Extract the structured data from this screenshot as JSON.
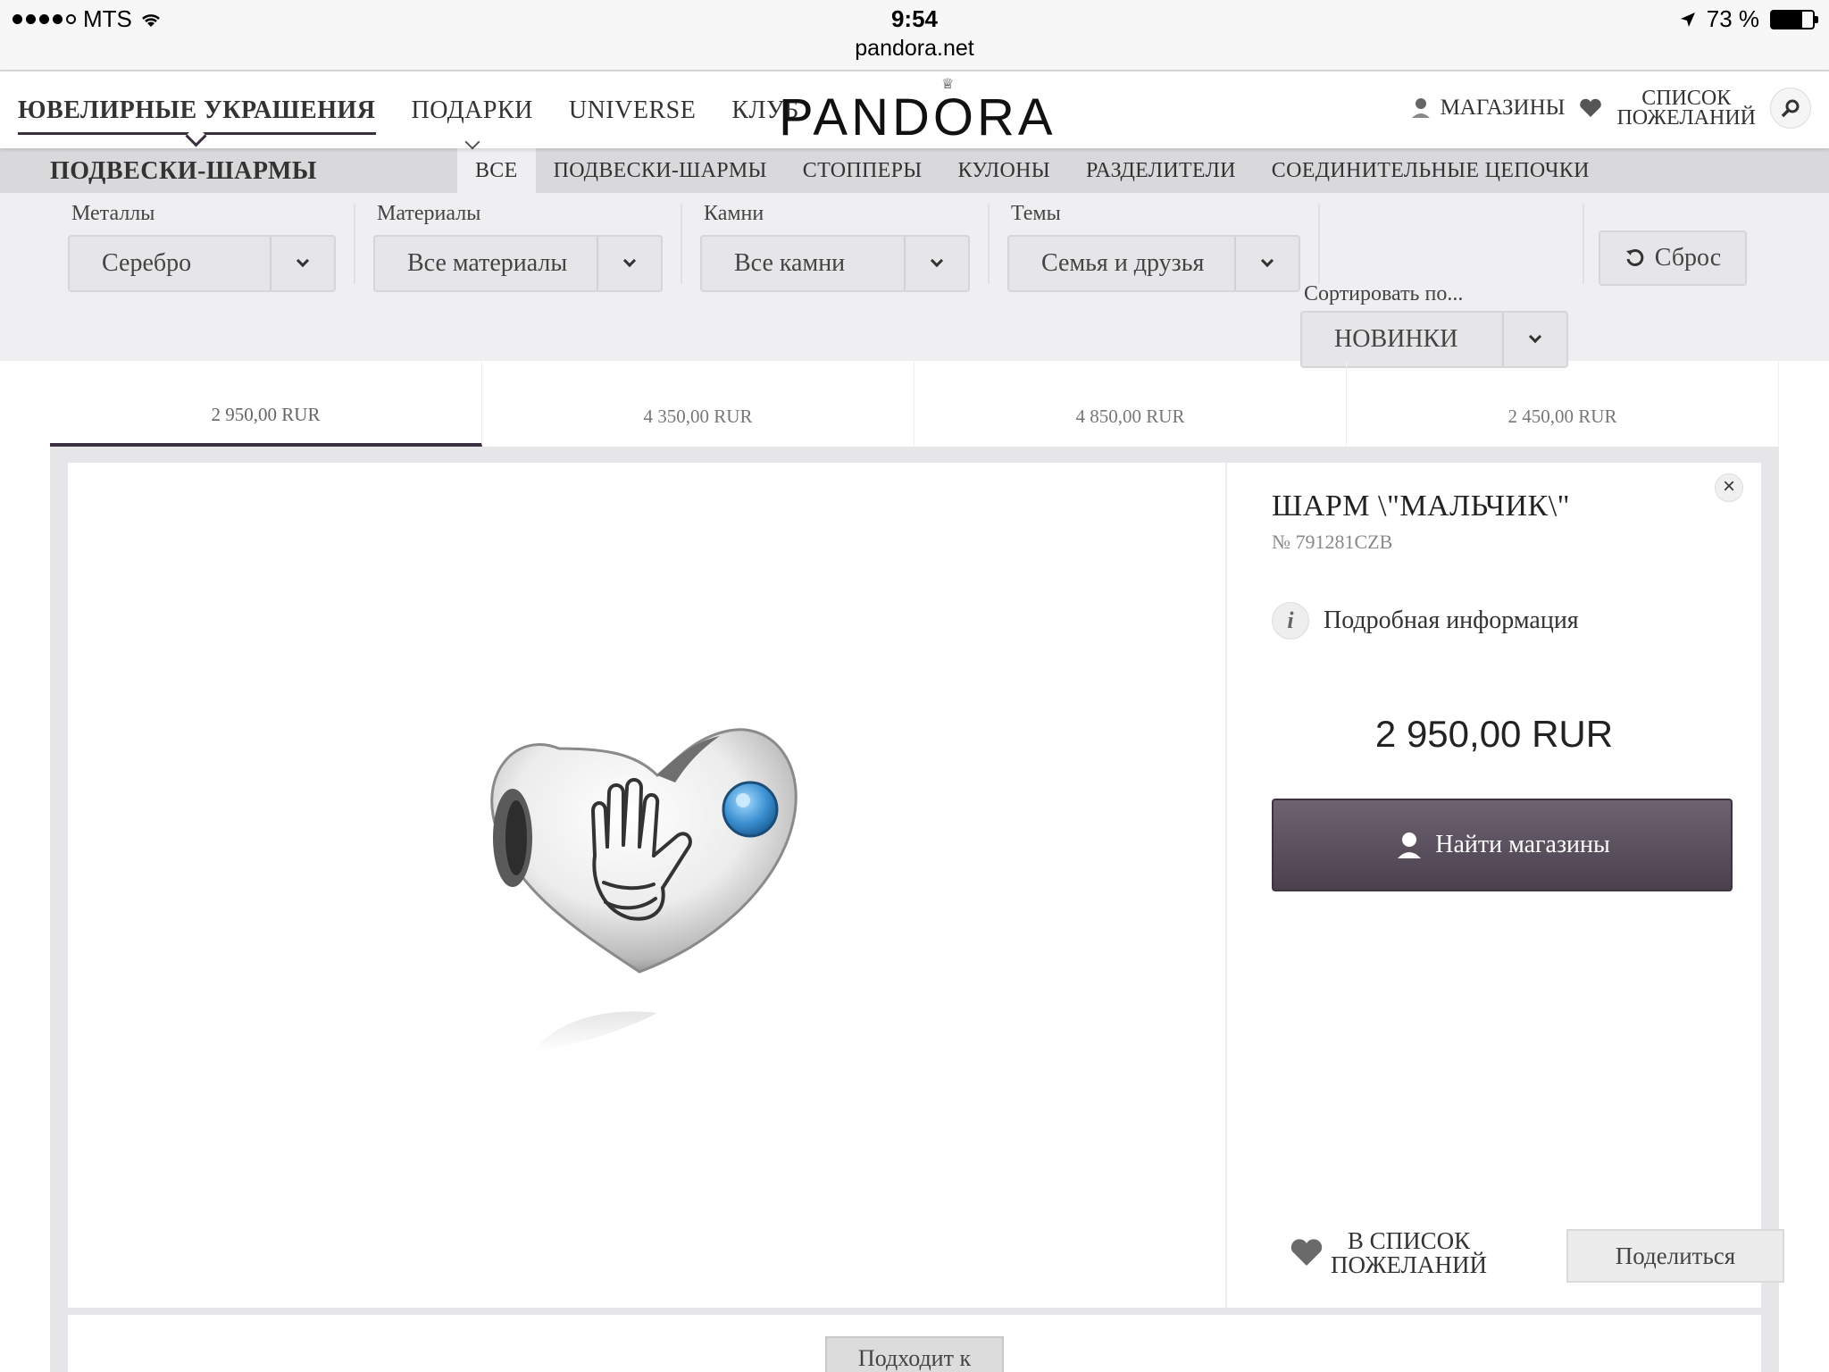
{
  "status_bar": {
    "carrier": "MTS",
    "time": "9:54",
    "url": "pandora.net",
    "battery": "73 %",
    "battery_level": 0.73
  },
  "header": {
    "nav": [
      "ЮВЕЛИРНЫЕ УКРАШЕНИЯ",
      "ПОДАРКИ",
      "UNIVERSE",
      "КЛУБ"
    ],
    "logo": "PANDORA",
    "stores": "МАГАЗИНЫ",
    "wishlist_line1": "СПИСОК",
    "wishlist_line2": "ПОЖЕЛАНИЙ"
  },
  "category": {
    "title": "ПОДВЕСКИ-ШАРМЫ",
    "tabs": [
      "ВСЕ",
      "ПОДВЕСКИ-ШАРМЫ",
      "СТОППЕРЫ",
      "КУЛОНЫ",
      "РАЗДЕЛИТЕЛИ",
      "СОЕДИНИТЕЛЬНЫЕ ЦЕПОЧКИ"
    ],
    "active_tab": "ВСЕ"
  },
  "filters": {
    "metals": {
      "label": "Металлы",
      "value": "Серебро"
    },
    "materials": {
      "label": "Материалы",
      "value": "Все материалы"
    },
    "stones": {
      "label": "Камни",
      "value": "Все камни"
    },
    "themes": {
      "label": "Темы",
      "value": "Семья и друзья"
    },
    "reset": "Сброс",
    "sort_label": "Сортировать по...",
    "sort_value": "НОВИНКИ"
  },
  "price_tabs": [
    "2 950,00 RUR",
    "4 350,00 RUR",
    "4 850,00 RUR",
    "2 450,00 RUR"
  ],
  "product": {
    "title": "ШАРМ \\\"МАЛЬЧИК\\\"",
    "sku": "№ 791281CZB",
    "details": "Подробная информация",
    "price": "2 950,00 RUR",
    "find_stores": "Найти магазины",
    "wishlist_line1": "В СПИСОК",
    "wishlist_line2": "ПОЖЕЛАНИЙ",
    "share": "Поделиться",
    "fits": "Подходит к"
  },
  "colors": {
    "accent": "#4a404e",
    "stone": "#3a8fd0"
  }
}
